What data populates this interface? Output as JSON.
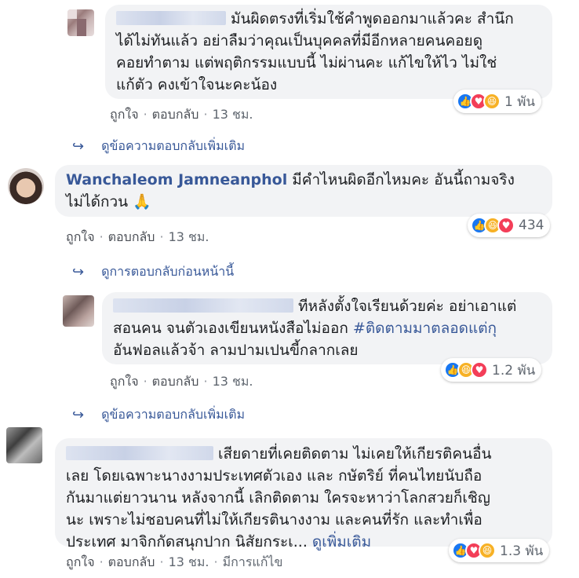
{
  "comments": [
    {
      "text_lines": [
        "มันผิดตรงที่เริ่มใช้คำพูดออกมาแล้วคะ สำนึก",
        "ได้ไม่ทันแล้ว อย่าลืมว่าคุณเป็นบุคคลที่มีอีกหลายคนคอยดู",
        "คอยทำตาม แต่พฤติกรรมแบบนี้ ไม่ผ่านคะ แก้ไขให้ไว ไม่ใช่",
        "แก้ตัว คงเข้าใจนะคะน้อง"
      ],
      "reactions": [
        "like",
        "love",
        "haha"
      ],
      "reaction_count": "1 พัน",
      "like": "ถูกใจ",
      "reply": "ตอบกลับ",
      "time": "13 ชม."
    },
    {
      "name": "Wanchaleom Jamneanphol",
      "text_lines": [
        "มีคำไหนผิดอีกไหมคะ อันนี้ถามจริง",
        "ไม่ได้กวน 🙏"
      ],
      "reactions": [
        "like",
        "haha",
        "love"
      ],
      "reaction_count": "434",
      "like": "ถูกใจ",
      "reply": "ตอบกลับ",
      "time": "13 ชม."
    },
    {
      "text_lines": [
        "ทีหลังตั้งใจเรียนด้วยค่ะ อย่าเอาแต่",
        "สอนคน จนตัวเองเขียนหนังสือไม่ออก ",
        "อันฟอลแล้วจ้า ลามปามเปนขี้กลากเลย"
      ],
      "hashtag_a": "#ติดตามมาตลอดแต่กุ",
      "reactions": [
        "like",
        "haha",
        "love"
      ],
      "reaction_count": "1.2 พัน",
      "like": "ถูกใจ",
      "reply": "ตอบกลับ",
      "time": "13 ชม."
    },
    {
      "text_lines": [
        "เสียดายที่เคยติดตาม ไม่เคยให้เกียรติคนอื่น",
        "เลย โดยเฉพาะนางงามประเทศตัวเอง และ กษัตริย์ ที่คนไทยนับถือ",
        "กันมาแต่ยาวนาน หลังจากนี้ เลิกติดตาม ใครจะหาว่าโลกสวยก็เชิญ",
        "นะ เพราะไม่ชอบคนที่ไม่ให้เกียรตินางงาม และคนที่รัก และทำเพื่อ",
        "ประเทศ มาจิกกัดสนุกปาก นิสัยกระเ..."
      ],
      "see_more": "ดูเพิ่มเติม",
      "reactions": [
        "like",
        "love",
        "haha"
      ],
      "reaction_count": "1.3 พัน",
      "like": "ถูกใจ",
      "reply": "ตอบกลับ",
      "time": "13 ชม.",
      "edited": "มีการแก้ไข"
    }
  ],
  "links": {
    "view_more_replies_1": "ดูข้อความตอบกลับเพิ่มเติม",
    "view_previous_replies": "ดูการตอบกลับก่อนหน้านี้",
    "view_more_replies_2": "ดูข้อความตอบกลับเพิ่มเติม"
  },
  "icons": {
    "like": "thumbs-up-icon",
    "love": "heart-icon",
    "haha": "laughing-face-icon",
    "reply_arrow": "reply-arrow-icon"
  },
  "colors": {
    "bubble": "#f2f3f5",
    "link": "#385898",
    "like": "#1877f2",
    "love": "#f33e58",
    "haha": "#f7b125"
  }
}
